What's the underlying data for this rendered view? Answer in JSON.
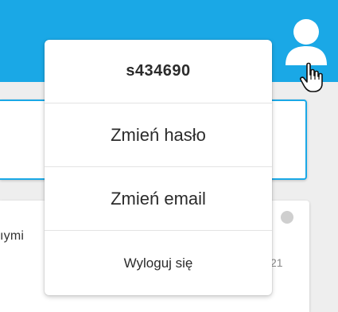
{
  "header": {
    "brand_color": "#1aa8e6"
  },
  "user_menu": {
    "username": "s434690",
    "change_password_label": "Zmień hasło",
    "change_email_label": "Zmień email",
    "logout_label": "Wyloguj się"
  },
  "post": {
    "snippet": "ıymi",
    "time": "21"
  },
  "icons": {
    "avatar": "user-icon",
    "cursor": "hand-pointer-icon",
    "status": "status-dot-icon"
  }
}
